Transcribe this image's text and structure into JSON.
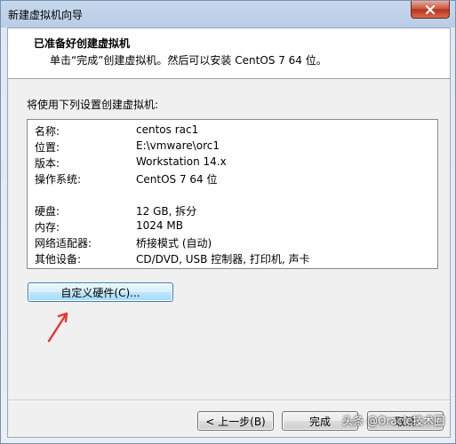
{
  "window": {
    "title": "新建虚拟机向导"
  },
  "header": {
    "title": "已准备好创建虚拟机",
    "subtitle": "单击“完成”创建虚拟机。然后可以安装 CentOS 7 64 位。"
  },
  "intro_label": "将使用下列设置创建虚拟机:",
  "summary": {
    "rows": [
      {
        "key": "名称:",
        "value": "centos rac1"
      },
      {
        "key": "位置:",
        "value": "E:\\vmware\\orc1"
      },
      {
        "key": "版本:",
        "value": "Workstation 14.x"
      },
      {
        "key": "操作系统:",
        "value": "CentOS 7 64 位"
      },
      {
        "key": "硬盘:",
        "value": "12 GB, 拆分"
      },
      {
        "key": "内存:",
        "value": "1024 MB"
      },
      {
        "key": "网络适配器:",
        "value": "桥接模式 (自动)"
      },
      {
        "key": "其他设备:",
        "value": "CD/DVD, USB 控制器, 打印机, 声卡"
      }
    ]
  },
  "buttons": {
    "customize": "自定义硬件(C)...",
    "back": "< 上一步(B)",
    "finish": "完成",
    "cancel": "取消"
  },
  "watermark": "头条 @Oracle技术圈",
  "colors": {
    "annotation_arrow": "#e8352b",
    "focused_button_border": "#3c7fb1"
  }
}
